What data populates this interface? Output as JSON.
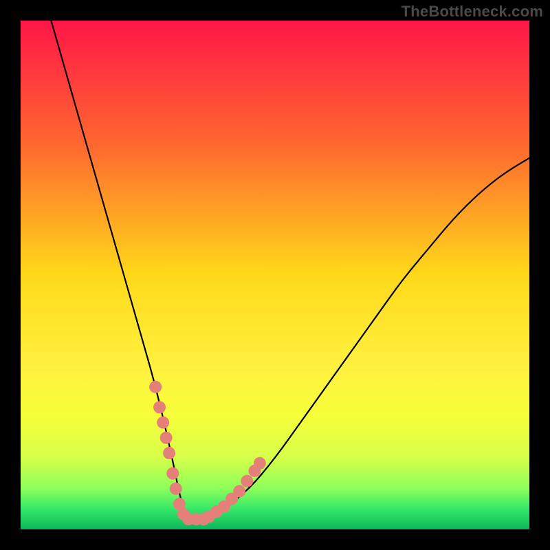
{
  "watermark": "TheBottleneck.com",
  "chart_data": {
    "type": "line",
    "title": "",
    "xlabel": "",
    "ylabel": "",
    "xlim": [
      0,
      100
    ],
    "ylim": [
      0,
      100
    ],
    "grid": false,
    "legend": false,
    "gradient_stops": [
      {
        "offset": 0,
        "color": "#ff1647"
      },
      {
        "offset": 25,
        "color": "#ff6a2f"
      },
      {
        "offset": 50,
        "color": "#ffd91a"
      },
      {
        "offset": 68,
        "color": "#fff13f"
      },
      {
        "offset": 78,
        "color": "#f6ff3a"
      },
      {
        "offset": 86,
        "color": "#d6ff4a"
      },
      {
        "offset": 92,
        "color": "#8cff5a"
      },
      {
        "offset": 96,
        "color": "#35e86a"
      },
      {
        "offset": 100,
        "color": "#0fb65a"
      }
    ],
    "series": [
      {
        "name": "bottleneck-curve",
        "color": "#000000",
        "x": [
          6,
          8,
          10,
          12,
          14,
          16,
          18,
          20,
          22,
          24,
          26,
          28,
          30,
          31,
          32,
          33,
          34,
          36,
          40,
          45,
          50,
          55,
          60,
          65,
          70,
          75,
          80,
          85,
          90,
          95,
          100
        ],
        "y": [
          100,
          93,
          86,
          79,
          72,
          65,
          58,
          51,
          44,
          37,
          30,
          22,
          13,
          8,
          4,
          2,
          2,
          2,
          4,
          8,
          14,
          21,
          28,
          35,
          42,
          49,
          55,
          61,
          66,
          70,
          73
        ]
      }
    ],
    "markers": {
      "name": "highlight-dots",
      "color": "#e58079",
      "radius_px": 9,
      "points": [
        {
          "x": 26.5,
          "y": 28
        },
        {
          "x": 27.3,
          "y": 24
        },
        {
          "x": 28.0,
          "y": 21
        },
        {
          "x": 28.6,
          "y": 18
        },
        {
          "x": 29.2,
          "y": 15
        },
        {
          "x": 29.9,
          "y": 11
        },
        {
          "x": 30.5,
          "y": 8
        },
        {
          "x": 31.2,
          "y": 5
        },
        {
          "x": 32.0,
          "y": 3
        },
        {
          "x": 33.0,
          "y": 2
        },
        {
          "x": 34.5,
          "y": 2
        },
        {
          "x": 36.0,
          "y": 2
        },
        {
          "x": 37.0,
          "y": 2.5
        },
        {
          "x": 38.5,
          "y": 3.5
        },
        {
          "x": 40.0,
          "y": 4.5
        },
        {
          "x": 41.5,
          "y": 6
        },
        {
          "x": 43.0,
          "y": 7.5
        },
        {
          "x": 44.5,
          "y": 9.5
        },
        {
          "x": 46.0,
          "y": 11.5
        },
        {
          "x": 47.0,
          "y": 13
        }
      ]
    }
  }
}
